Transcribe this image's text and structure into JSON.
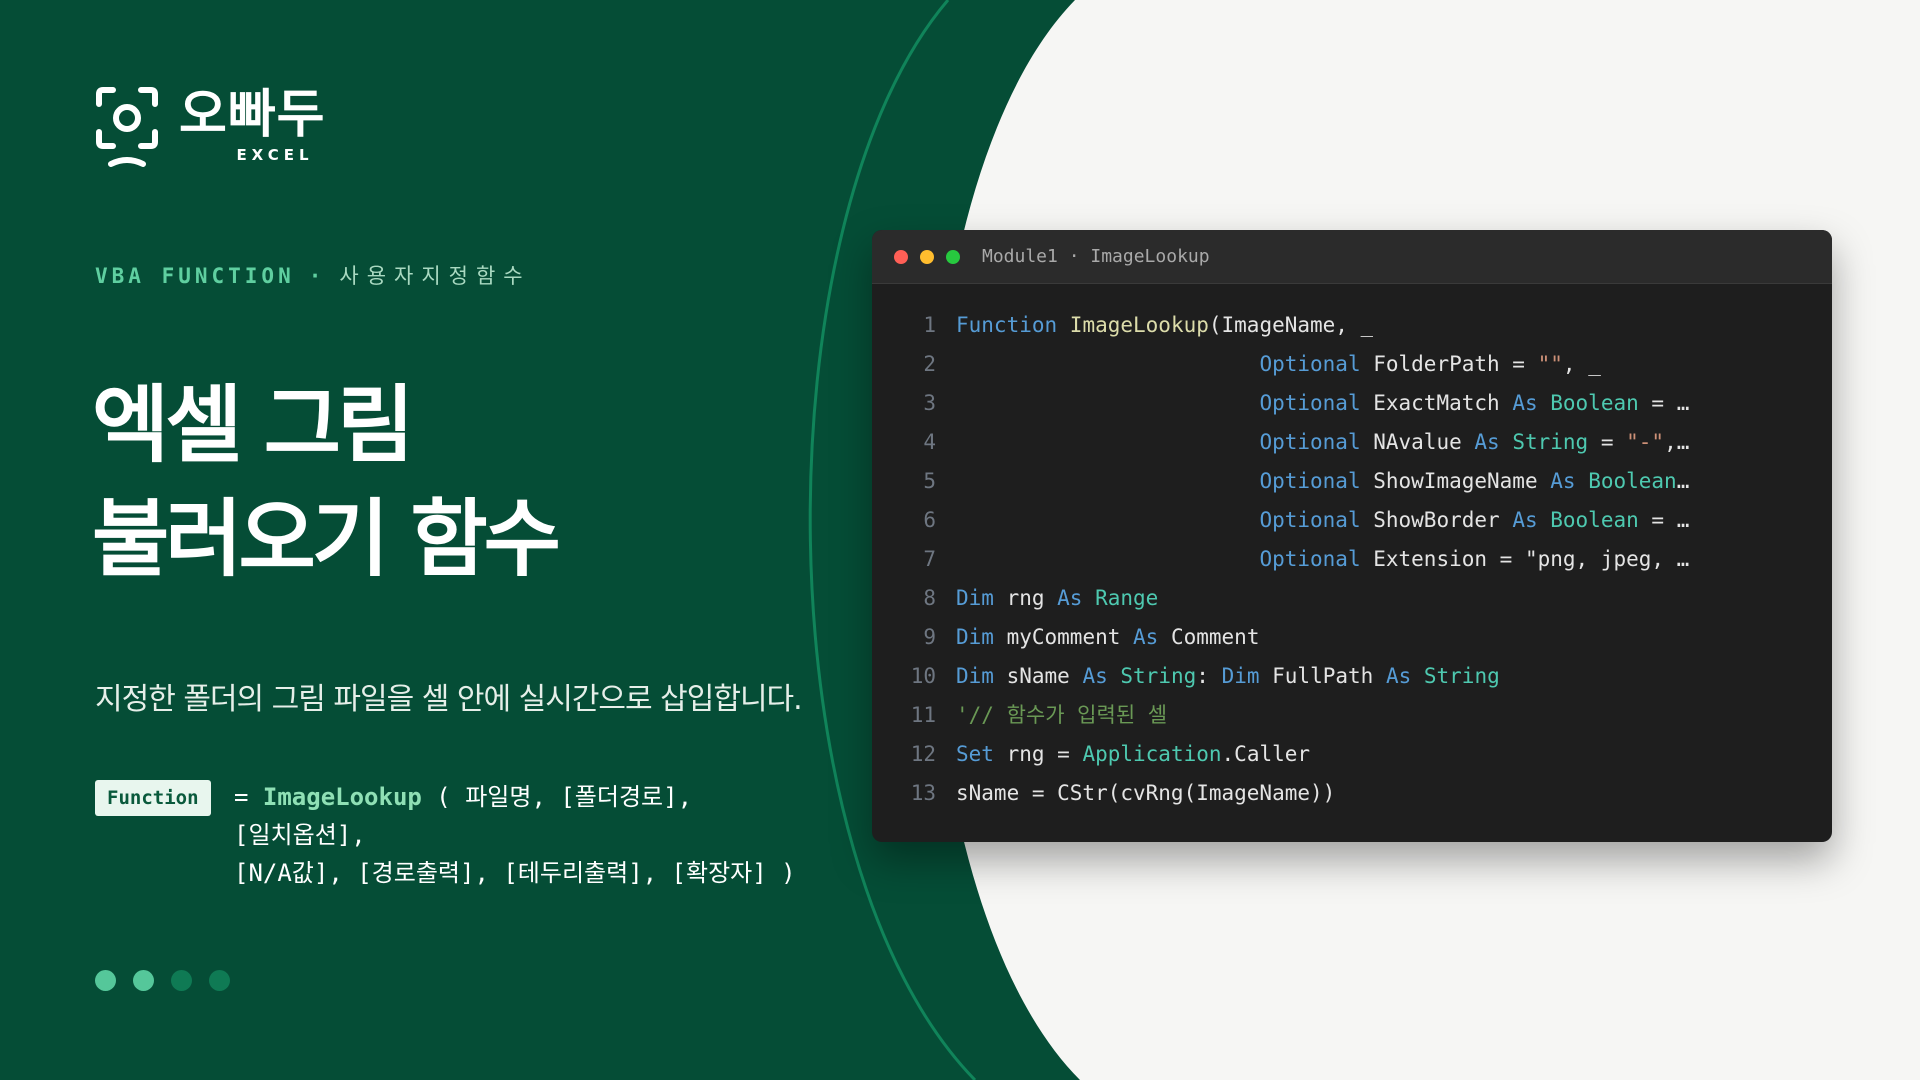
{
  "brand": {
    "name": "오빠두",
    "sub": "EXCEL"
  },
  "tagline": {
    "en": "VBA FUNCTION",
    "sep": "·",
    "ko": "사용자지정함수"
  },
  "title": {
    "line1": "엑셀 그림",
    "line2": "불러오기 함수"
  },
  "description": "지정한 폴더의 그림 파일을 셀 안에 실시간으로 삽입합니다.",
  "syntax": {
    "badge": "Function",
    "line1_prefix": "= ",
    "line1_fn": "ImageLookup",
    "line1_args": " ( 파일명, [폴더경로],",
    "line2": "[일치옵션],",
    "line3": "[N/A값], [경로출력], [테두리출력], [확장자] )"
  },
  "colors": {
    "green_dark": "#054d36",
    "accent": "#5fcfa0",
    "dot_active": "#55c79a",
    "dot_inactive": "#0f7a54",
    "window_bg": "#1e1e1e"
  },
  "pager": {
    "count": 4,
    "active": [
      0,
      1
    ]
  },
  "window": {
    "title": "Module1 · ImageLookup",
    "buttons": [
      "close",
      "minimize",
      "maximize"
    ]
  },
  "code": [
    {
      "n": "1",
      "tokens": [
        [
          "kw",
          "Function "
        ],
        [
          "fnc",
          "ImageLookup"
        ],
        [
          "",
          "(ImageName, _"
        ]
      ]
    },
    {
      "n": "2",
      "tokens": [
        [
          "",
          "                        "
        ],
        [
          "kw",
          "Optional"
        ],
        [
          "",
          " FolderPath = "
        ],
        [
          "st",
          "\"\""
        ],
        [
          "",
          ", _"
        ]
      ]
    },
    {
      "n": "3",
      "tokens": [
        [
          "",
          "                        "
        ],
        [
          "kw",
          "Optional"
        ],
        [
          "",
          " ExactMatch "
        ],
        [
          "kw",
          "As"
        ],
        [
          "",
          ""
        ],
        [
          "ty",
          " Boolean"
        ],
        [
          "",
          " = …"
        ]
      ]
    },
    {
      "n": "4",
      "tokens": [
        [
          "",
          "                        "
        ],
        [
          "kw",
          "Optional"
        ],
        [
          "",
          " NAvalue "
        ],
        [
          "kw",
          "As"
        ],
        [
          "ty",
          " String"
        ],
        [
          "",
          " = "
        ],
        [
          "st",
          "\"-\""
        ],
        [
          "",
          ",…"
        ]
      ]
    },
    {
      "n": "5",
      "tokens": [
        [
          "",
          "                        "
        ],
        [
          "kw",
          "Optional"
        ],
        [
          "",
          " ShowImageName "
        ],
        [
          "kw",
          "As"
        ],
        [
          "ty",
          " Boolean"
        ],
        [
          "",
          "…"
        ]
      ]
    },
    {
      "n": "6",
      "tokens": [
        [
          "",
          "                        "
        ],
        [
          "kw",
          "Optional"
        ],
        [
          "",
          " ShowBorder "
        ],
        [
          "kw",
          "As"
        ],
        [
          "ty",
          " Boolean"
        ],
        [
          "",
          " = …"
        ]
      ]
    },
    {
      "n": "7",
      "tokens": [
        [
          "",
          "                        "
        ],
        [
          "kw",
          "Optional"
        ],
        [
          "",
          " Extension = \"png, jpeg, …"
        ]
      ]
    },
    {
      "n": "8",
      "tokens": [
        [
          "kw",
          "Dim"
        ],
        [
          "",
          " rng "
        ],
        [
          "kw",
          "As"
        ],
        [
          "ty",
          " Range"
        ]
      ]
    },
    {
      "n": "9",
      "tokens": [
        [
          "kw",
          "Dim"
        ],
        [
          "",
          " myComment "
        ],
        [
          "kw",
          "As"
        ],
        [
          "",
          " Comment"
        ]
      ]
    },
    {
      "n": "10",
      "tokens": [
        [
          "kw",
          "Dim"
        ],
        [
          "",
          " sName "
        ],
        [
          "kw",
          "As"
        ],
        [
          "ty",
          " String"
        ],
        [
          "",
          ": "
        ],
        [
          "kw",
          "Dim"
        ],
        [
          "",
          " FullPath "
        ],
        [
          "kw",
          "As"
        ],
        [
          "ty",
          " String"
        ]
      ]
    },
    {
      "n": "11",
      "tokens": [
        [
          "cm",
          "'// 함수가 입력된 셀"
        ]
      ]
    },
    {
      "n": "12",
      "tokens": [
        [
          "kw",
          "Set"
        ],
        [
          "",
          " rng = "
        ],
        [
          "ty",
          "Application"
        ],
        [
          "",
          ".Caller"
        ]
      ]
    },
    {
      "n": "13",
      "tokens": [
        [
          "",
          "sName = CStr(cvRng(ImageName))"
        ]
      ]
    }
  ]
}
